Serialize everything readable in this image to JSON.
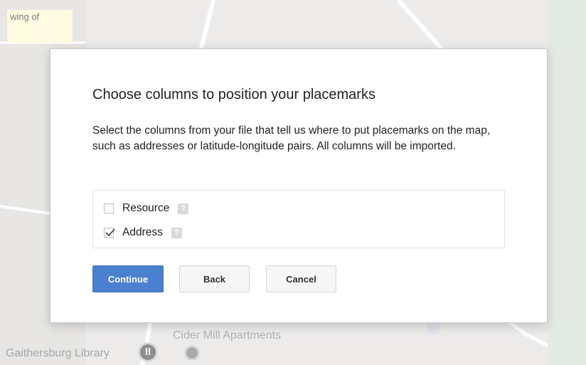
{
  "map": {
    "panel_text": "wing of",
    "place_labels": [
      "Cider Mill Apartments",
      "Gaithersburg Library"
    ]
  },
  "dialog": {
    "title": "Choose columns to position your placemarks",
    "description": "Select the columns from your file that tell us where to put placemarks on the map, such as addresses or latitude-longitude pairs. All columns will be imported.",
    "columns": [
      {
        "label": "Resource",
        "checked": false,
        "help": "?"
      },
      {
        "label": "Address",
        "checked": true,
        "help": "?"
      }
    ],
    "buttons": {
      "continue": "Continue",
      "back": "Back",
      "cancel": "Cancel"
    }
  },
  "colors": {
    "primary_button": "#4a80cf",
    "map_background": "#ecebea"
  }
}
